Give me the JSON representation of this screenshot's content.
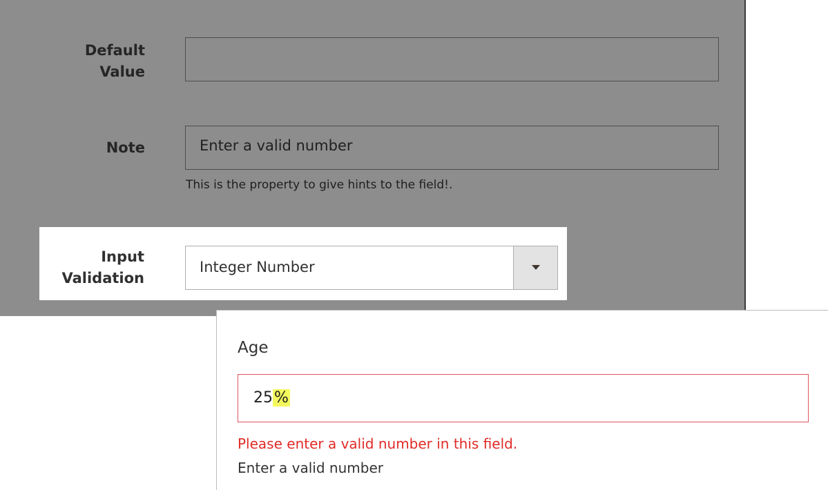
{
  "admin": {
    "default_value": {
      "label_line1": "Default",
      "label_line2": "Value",
      "value": ""
    },
    "note": {
      "label": "Note",
      "value": "Enter a valid number",
      "hint": "This is the property to give hints to the field!."
    },
    "input_validation": {
      "label_line1": "Input",
      "label_line2": "Validation",
      "selected": "Integer Number"
    }
  },
  "storefront": {
    "field_label": "Age",
    "value_digits": "25",
    "value_highlighted": "%",
    "error": "Please enter a valid number in this field.",
    "note": "Enter a valid number"
  }
}
